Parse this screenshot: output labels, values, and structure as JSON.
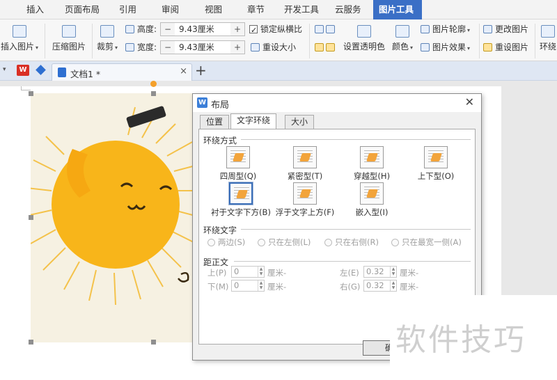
{
  "menu": {
    "tabs": [
      {
        "label": "插入"
      },
      {
        "label": "页面布局"
      },
      {
        "label": "引用"
      },
      {
        "label": "审阅"
      },
      {
        "label": "视图"
      },
      {
        "label": "章节"
      },
      {
        "label": "开发工具"
      },
      {
        "label": "云服务"
      },
      {
        "label": "图片工具",
        "active": true
      }
    ]
  },
  "ribbon": {
    "insert_picture": "插入图片",
    "compress_picture": "压缩图片",
    "crop": "裁剪",
    "height_label": "高度:",
    "height_value": "9.43厘米",
    "width_label": "宽度:",
    "width_value": "9.43厘米",
    "lock_ratio": "锁定纵横比",
    "reset_size": "重设大小",
    "transparent_color": "设置透明色",
    "color": "颜色",
    "picture_outline": "图片轮廓",
    "picture_effect": "图片效果",
    "change_picture": "更改图片",
    "reset_picture": "重设图片",
    "wrap": "环绕",
    "minus": "−",
    "plus": "+"
  },
  "doc_tabs": {
    "current_doc": "文档1 *",
    "close": "×",
    "new_tab": "+"
  },
  "dialog": {
    "title": "布局",
    "close": "✕",
    "tabs": [
      {
        "label": "位置"
      },
      {
        "label": "文字环绕",
        "active": true
      },
      {
        "label": "大小"
      }
    ],
    "wrap_section": "环绕方式",
    "wrap_options": [
      {
        "label": "四周型(Q)"
      },
      {
        "label": "紧密型(T)"
      },
      {
        "label": "穿越型(H)"
      },
      {
        "label": "上下型(O)"
      },
      {
        "label": "衬于文字下方(B)",
        "selected": true
      },
      {
        "label": "浮于文字上方(F)"
      },
      {
        "label": "嵌入型(I)"
      }
    ],
    "wrap_text_section": "环绕文字",
    "wrap_text_options": [
      {
        "label": "两边(S)"
      },
      {
        "label": "只在左侧(L)"
      },
      {
        "label": "只在右侧(R)"
      },
      {
        "label": "只在最宽一侧(A)"
      }
    ],
    "distance_section": "距正文",
    "distance": {
      "top_label": "上(P)",
      "top_value": "0",
      "top_unit": "厘米-",
      "bottom_label": "下(M)",
      "bottom_value": "0",
      "bottom_unit": "厘米-",
      "left_label": "左(E)",
      "left_value": "0.32",
      "left_unit": "厘米-",
      "right_label": "右(G)",
      "right_value": "0.32",
      "right_unit": "厘米-"
    },
    "ok_button": "确"
  },
  "watermark": "软件技巧"
}
